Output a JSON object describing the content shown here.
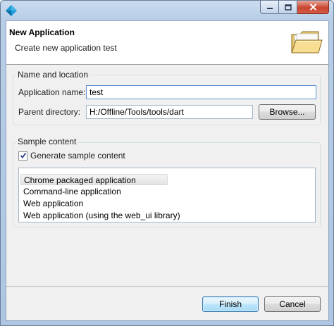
{
  "window": {
    "app_icon": "dart-diamond-icon",
    "minimize_icon": "minimize-icon",
    "maximize_icon": "maximize-icon",
    "close_icon": "close-icon"
  },
  "header": {
    "title": "New Application",
    "description": "Create new application test",
    "icon": "folder-open-icon"
  },
  "name_location": {
    "group_label": "Name and location",
    "app_name_label": "Application name:",
    "app_name_value": "test",
    "parent_dir_label": "Parent directory:",
    "parent_dir_value": "H:/Offline/Tools/tools/dart",
    "browse_label": "Browse..."
  },
  "sample_content": {
    "group_label": "Sample content",
    "generate_label": "Generate sample content",
    "generate_checked": true,
    "items": [
      {
        "label": "Chrome packaged application",
        "selected": true
      },
      {
        "label": "Command-line application",
        "selected": false
      },
      {
        "label": "Web application",
        "selected": false
      },
      {
        "label": "Web application (using the web_ui library)",
        "selected": false
      }
    ]
  },
  "footer": {
    "finish_label": "Finish",
    "cancel_label": "Cancel"
  },
  "colors": {
    "accent": "#3c7fb1",
    "header_bg": "#ffffff",
    "client_bg": "#f0f0f0"
  }
}
